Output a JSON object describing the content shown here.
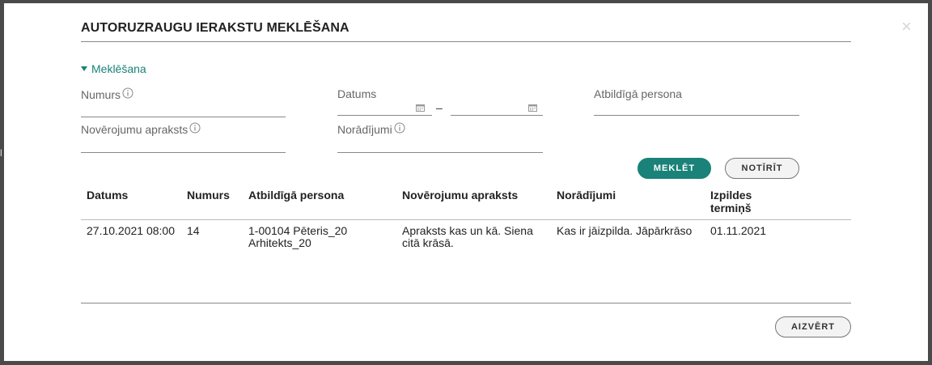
{
  "dialog": {
    "title": "AUTORUZRAUGU IERAKSTU MEKLĒŠANA",
    "close_glyph": "×"
  },
  "search": {
    "toggle_label": "Meklēšana",
    "fields": {
      "numurs": "Numurs",
      "datums": "Datums",
      "atbildiga_persona": "Atbildīgā persona",
      "noverojumu_apraksts": "Novērojumu apraksts",
      "noradijumi": "Norādījumi"
    },
    "date_separator": "–",
    "buttons": {
      "search": "MEKLĒT",
      "clear": "NOTĪRĪT"
    }
  },
  "table": {
    "headers": {
      "datums": "Datums",
      "numurs": "Numurs",
      "persona": "Atbildīgā persona",
      "apraksts": "Novērojumu apraksts",
      "noradijumi": "Norādījumi",
      "termins_1": "Izpildes",
      "termins_2": "termiņš"
    },
    "rows": [
      {
        "datums": "27.10.2021 08:00",
        "numurs": "14",
        "persona_1": "1-00104 Pēteris_20",
        "persona_2": "Arhitekts_20",
        "apraksts_1": "Apraksts kas un kā. Siena",
        "apraksts_2": "citā krāsā.",
        "noradijumi": "Kas ir jāizpilda. Jāpārkrāso",
        "termins": "01.11.2021"
      }
    ]
  },
  "footer": {
    "close_button": "AIZVĒRT"
  },
  "colors": {
    "accent": "#1a8278",
    "overlay": "#4a4a4a"
  },
  "icons": [
    "info-icon",
    "calendar-icon",
    "caret-down-icon",
    "close-icon"
  ]
}
